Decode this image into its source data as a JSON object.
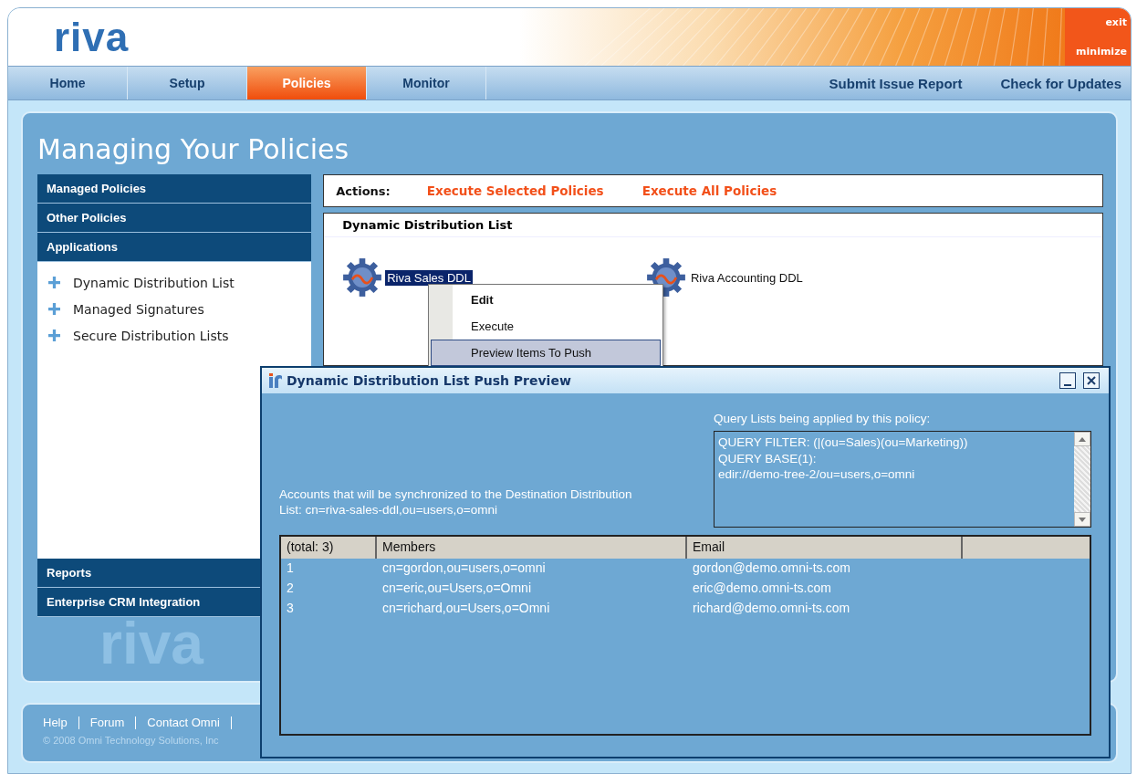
{
  "app": {
    "logo": "riva",
    "window_controls": [
      "exit",
      "minimize"
    ]
  },
  "nav": {
    "tabs": [
      {
        "label": "Home",
        "selected": false
      },
      {
        "label": "Setup",
        "selected": false
      },
      {
        "label": "Policies",
        "selected": true
      },
      {
        "label": "Monitor",
        "selected": false
      }
    ],
    "links": [
      "Submit Issue Report",
      "Check for Updates"
    ]
  },
  "page_title": "Managing Your Policies",
  "sidebar": {
    "sections": [
      {
        "label": "Managed Policies"
      },
      {
        "label": "Other Policies"
      },
      {
        "label": "Applications",
        "items": [
          "Dynamic Distribution List",
          "Managed Signatures",
          "Secure Distribution Lists"
        ]
      },
      {
        "label": "Reports"
      },
      {
        "label": "Enterprise CRM Integration"
      }
    ],
    "watermark": "riva"
  },
  "actions": {
    "label": "Actions:",
    "links": [
      "Execute Selected Policies",
      "Execute All Policies"
    ]
  },
  "policy_panel": {
    "title": "Dynamic Distribution List",
    "policies": [
      {
        "name": "Riva Sales DDL",
        "selected": true
      },
      {
        "name": "Riva Accounting DDL",
        "selected": false
      }
    ]
  },
  "context_menu": {
    "items": [
      {
        "label": "Edit",
        "default": true,
        "selected": false
      },
      {
        "label": "Execute",
        "default": false,
        "selected": false
      },
      {
        "label": "Preview Items To Push",
        "default": false,
        "selected": true
      }
    ]
  },
  "dialog": {
    "title": "Dynamic Distribution List Push Preview",
    "description": "Accounts that will be synchronized to the Destination Distribution List: cn=riva-sales-ddl,ou=users,o=omni",
    "query_label": "Query Lists being applied by this policy:",
    "query_lines": [
      "QUERY FILTER: (|(ou=Sales)(ou=Marketing))",
      "QUERY BASE(1):",
      "edir://demo-tree-2/ou=users,o=omni"
    ],
    "table": {
      "columns": [
        "(total: 3)",
        "Members",
        "Email"
      ],
      "rows": [
        [
          "1",
          "cn=gordon,ou=users,o=omni",
          "gordon@demo.omni-ts.com"
        ],
        [
          "2",
          "cn=eric,ou=Users,o=Omni",
          "eric@demo.omni-ts.com"
        ],
        [
          "3",
          "cn=richard,ou=Users,o=Omni",
          "richard@demo.omni-ts.com"
        ]
      ]
    }
  },
  "footer": {
    "links": [
      "Help",
      "Forum",
      "Contact Omni"
    ],
    "copyright": "© 2008 Omni Technology Solutions, Inc"
  }
}
